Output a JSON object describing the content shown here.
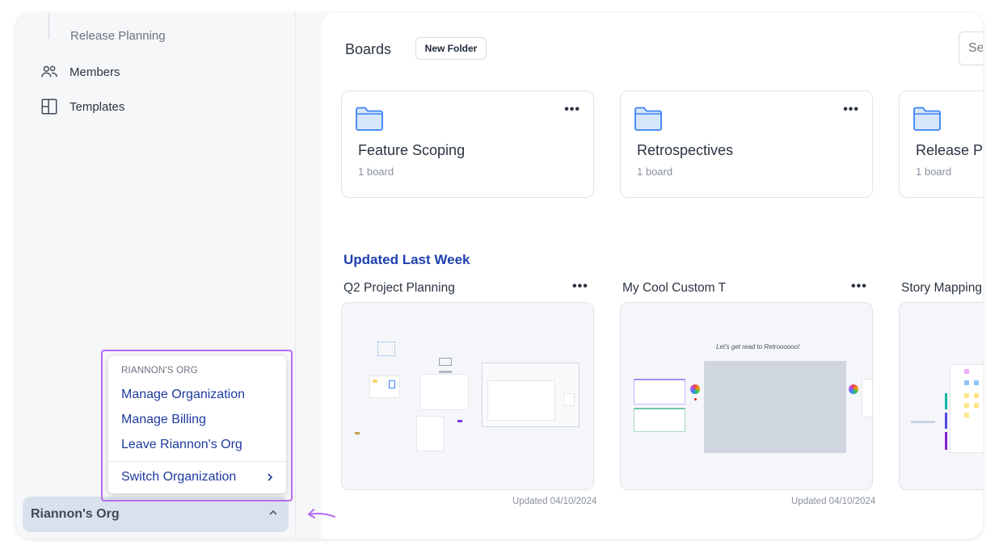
{
  "sidebar": {
    "sub_item": "Release Planning",
    "items": [
      {
        "label": "Members",
        "icon": "members-icon"
      },
      {
        "label": "Templates",
        "icon": "templates-icon"
      }
    ],
    "org_name": "Riannon's Org"
  },
  "org_menu": {
    "heading": "RIANNON'S ORG",
    "items": [
      "Manage Organization",
      "Manage Billing",
      "Leave Riannon's Org"
    ],
    "switch_label": "Switch Organization"
  },
  "main": {
    "title": "Boards",
    "new_folder_label": "New Folder",
    "search_placeholder": "Search",
    "folders": [
      {
        "name": "Feature Scoping",
        "count": "1 board"
      },
      {
        "name": "Retrospectives",
        "count": "1 board"
      },
      {
        "name": "Release Planning",
        "count": "1 board"
      }
    ],
    "section_title": "Updated Last Week",
    "boards": [
      {
        "title": "Q2 Project Planning",
        "updated": "Updated 04/10/2024"
      },
      {
        "title": "My Cool Custom T",
        "updated": "Updated 04/10/2024"
      },
      {
        "title": "Story Mapping",
        "updated": ""
      }
    ],
    "board_preview_text": "Let's get read to Retroooooo!"
  },
  "colors": {
    "accent": "#1e3fae",
    "highlight": "#b46cf0",
    "folder_fill": "#d6e6fb",
    "folder_stroke": "#3b82f6"
  }
}
